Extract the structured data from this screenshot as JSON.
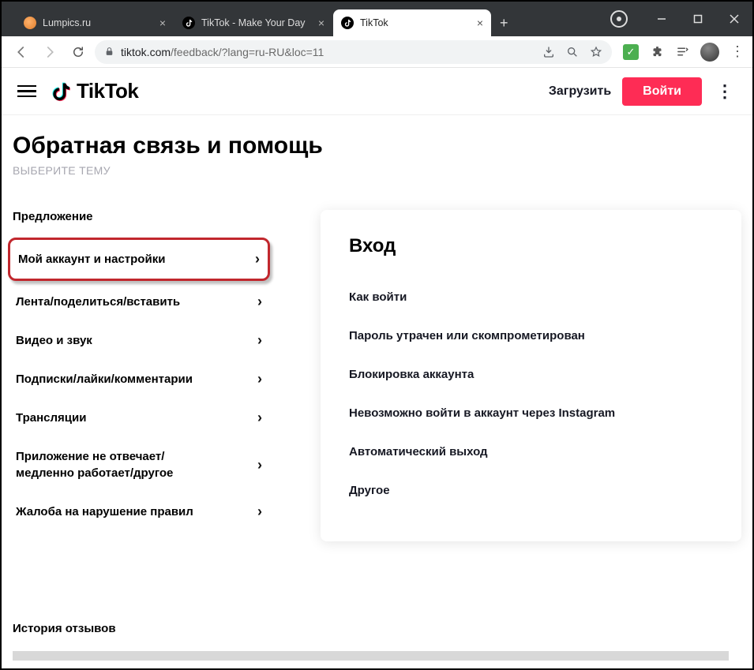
{
  "browser": {
    "tabs": [
      {
        "title": "Lumpics.ru",
        "favicon": "orange",
        "active": false
      },
      {
        "title": "TikTok - Make Your Day",
        "favicon": "tiktok",
        "active": false
      },
      {
        "title": "TikTok",
        "favicon": "tiktok",
        "active": true
      }
    ],
    "url_host": "tiktok.com",
    "url_path": "/feedback/?lang=ru-RU&loc=11"
  },
  "tt_header": {
    "brand": "TikTok",
    "upload": "Загрузить",
    "login": "Войти"
  },
  "page": {
    "title": "Обратная связь и помощь",
    "subtitle": "ВЫБЕРИТЕ ТЕМУ",
    "sidebar_heading": "Предложение",
    "sidebar_items": [
      "Мой аккаунт и настройки",
      "Лента/поделиться/вставить",
      "Видео и звук",
      "Подписки/лайки/комментарии",
      "Трансляции",
      "Приложение не отвечает/медленно работает/другое",
      "Жалоба на нарушение правил"
    ],
    "panel_title": "Вход",
    "panel_items": [
      "Как войти",
      "Пароль утрачен или скомпрометирован",
      "Блокировка аккаунта",
      "Невозможно войти в аккаунт через Instagram",
      "Автоматический выход",
      "Другое"
    ],
    "history_heading": "История отзывов"
  }
}
